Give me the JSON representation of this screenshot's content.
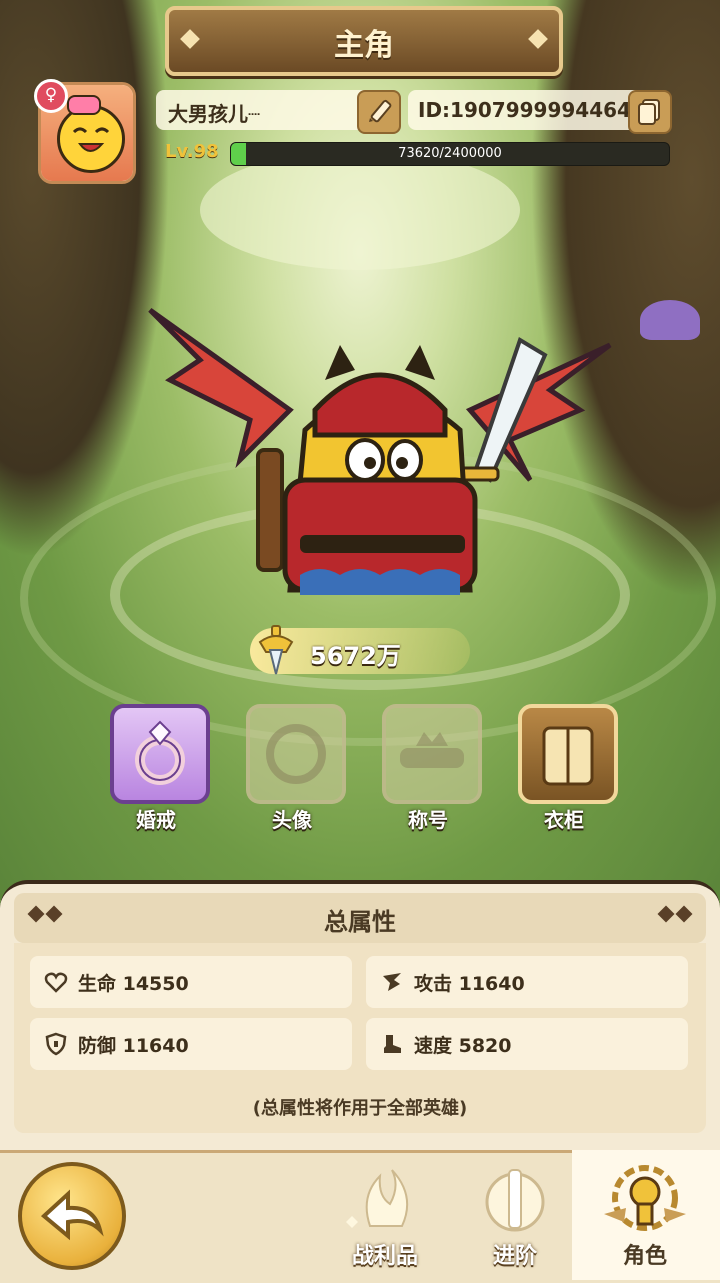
{
  "header": {
    "title": "主角"
  },
  "player": {
    "name": "大男孩儿┈",
    "id_text": "ID:1907999994464",
    "avatar_level": "98",
    "gender_symbol": "♀",
    "level_text": "Lv.98",
    "xp_text": "73620/2400000",
    "xp_fraction": 0.0307
  },
  "power": {
    "value": "5672万"
  },
  "features": [
    {
      "label": "婚戒",
      "state": "active"
    },
    {
      "label": "头像",
      "state": "locked"
    },
    {
      "label": "称号",
      "state": "locked"
    },
    {
      "label": "衣柜",
      "state": "active"
    }
  ],
  "attributes": {
    "title": "总属性",
    "stats": [
      {
        "label": "生命 14550",
        "icon": "heart-icon"
      },
      {
        "label": "攻击 11640",
        "icon": "claw-icon"
      },
      {
        "label": "防御 11640",
        "icon": "shield-icon"
      },
      {
        "label": "速度 5820",
        "icon": "boot-icon"
      }
    ],
    "note": "(总属性将作用于全部英雄)"
  },
  "nav": {
    "items": [
      {
        "label": "战利品",
        "icon": "loot-icon"
      },
      {
        "label": "进阶",
        "icon": "sword-emblem-icon"
      },
      {
        "label": "角色",
        "icon": "character-icon",
        "active": true
      }
    ]
  },
  "colors": {
    "accent": "#f0c23a",
    "xp_fill": "#5fcf4b",
    "panel": "#f4ead4"
  }
}
